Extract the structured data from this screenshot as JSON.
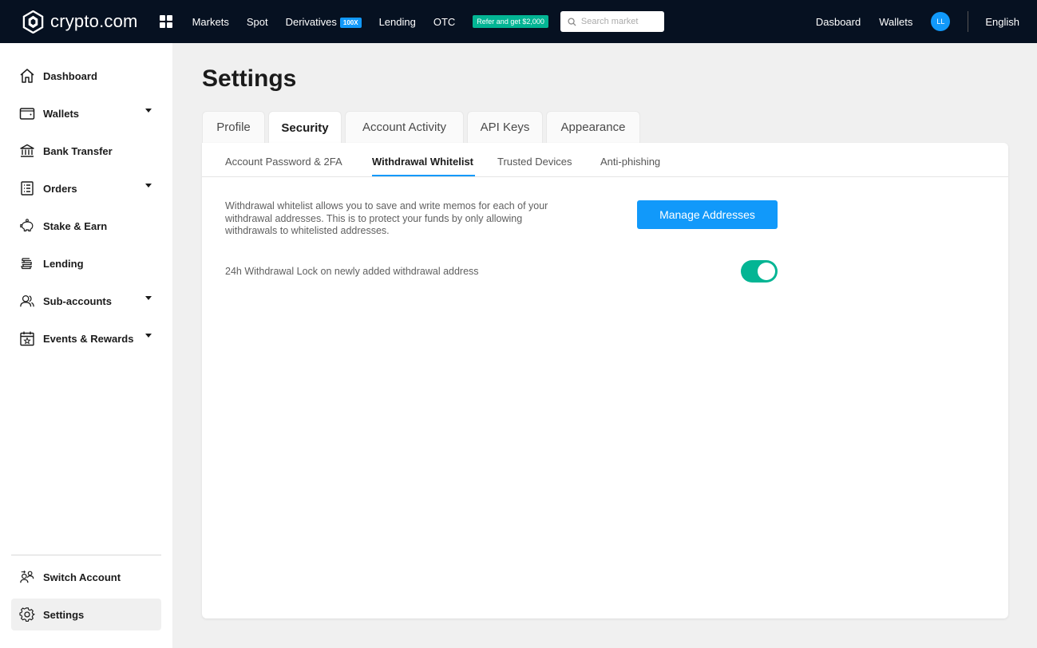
{
  "colors": {
    "topbar_bg": "#061121",
    "accent": "#1199fa",
    "success": "#03b594",
    "page_bg": "#f0f0f0"
  },
  "topbar": {
    "logo_text": "crypto.com",
    "nav": [
      "Markets",
      "Spot",
      "Derivatives",
      "Lending",
      "OTC"
    ],
    "derivatives_badge": "100X",
    "refer_badge": "Refer and get $2,000",
    "search_placeholder": "Search market",
    "dashboard_link": "Dasboard",
    "wallets_link": "Wallets",
    "avatar_initials": "LL",
    "language": "English"
  },
  "sidebar": {
    "items": [
      {
        "label": "Dashboard",
        "icon": "home-icon"
      },
      {
        "label": "Wallets",
        "icon": "wallet-icon",
        "dropdown": true
      },
      {
        "label": "Bank Transfer",
        "icon": "bank-icon"
      },
      {
        "label": "Orders",
        "icon": "orders-icon",
        "dropdown": true
      },
      {
        "label": "Stake & Earn",
        "icon": "piggy-bank-icon"
      },
      {
        "label": "Lending",
        "icon": "coin-stack-icon"
      },
      {
        "label": "Sub-accounts",
        "icon": "users-icon",
        "dropdown": true
      },
      {
        "label": "Events & Rewards",
        "icon": "calendar-star-icon",
        "dropdown": true
      }
    ],
    "bottom": [
      {
        "label": "Switch Account",
        "icon": "switch-account-icon"
      },
      {
        "label": "Settings",
        "icon": "gear-icon",
        "active": true
      }
    ]
  },
  "main": {
    "title": "Settings",
    "tabs": [
      "Profile",
      "Security",
      "Account Activity",
      "API Keys",
      "Appearance"
    ],
    "active_tab": "Security",
    "subtabs": [
      "Account Password & 2FA",
      "Withdrawal Whitelist",
      "Trusted Devices",
      "Anti-phishing"
    ],
    "active_subtab": "Withdrawal Whitelist",
    "description_lines": [
      "Withdrawal whitelist allows you to save and write memos for each of your",
      "withdrawal addresses. This is to protect your funds by only allowing",
      "withdrawals to whitelisted addresses."
    ],
    "manage_button": "Manage Addresses",
    "lock_label": "24h Withdrawal Lock on newly added withdrawal address",
    "lock_enabled": true
  }
}
